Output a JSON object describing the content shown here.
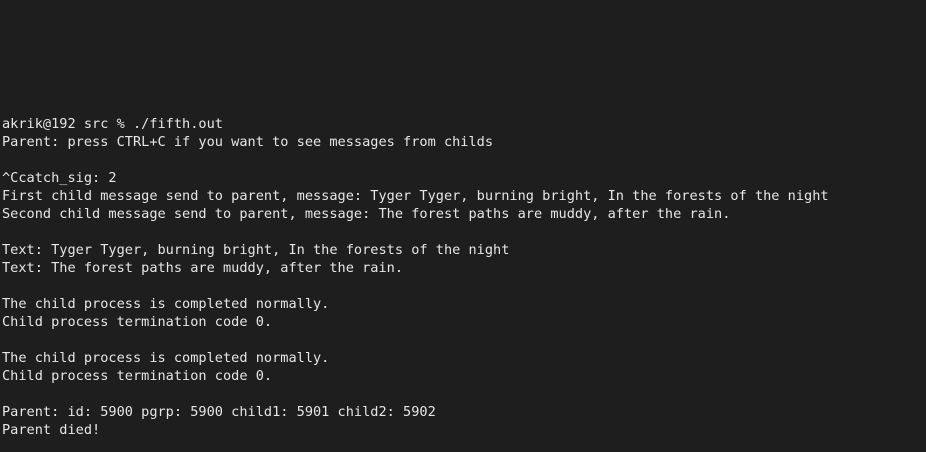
{
  "terminal": {
    "lines": [
      "akrik@192 src % ./fifth.out",
      "Parent: press CTRL+C if you want to see messages from childs",
      "",
      "^Ccatch_sig: 2",
      "First child message send to parent, message: Tyger Tyger, burning bright, In the forests of the night",
      "Second child message send to parent, message: The forest paths are muddy, after the rain.",
      "",
      "Text: Tyger Tyger, burning bright, In the forests of the night",
      "Text: The forest paths are muddy, after the rain.",
      "",
      "The child process is completed normally.",
      "Child process termination code 0.",
      "",
      "The child process is completed normally.",
      "Child process termination code 0.",
      "",
      "Parent: id: 5900 pgrp: 5900 child1: 5901 child2: 5902",
      "Parent died!"
    ]
  },
  "colors": {
    "background": "#1e1e1e",
    "text": "#e6e6e6"
  }
}
